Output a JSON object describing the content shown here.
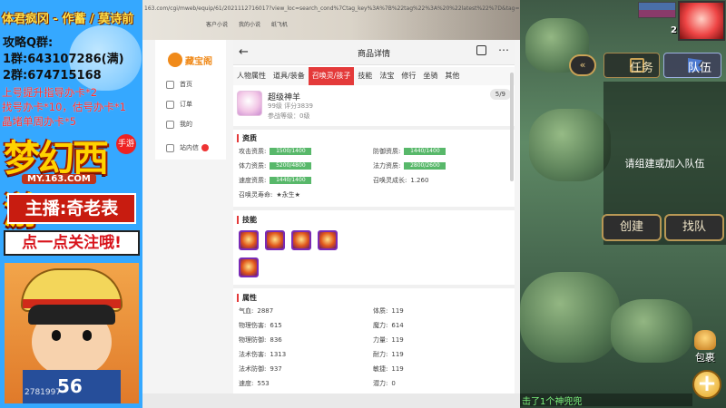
{
  "overlay": {
    "stream_title": "体君疯冈 - 作蓄 / 莫诗前",
    "qq_heading": "攻略Q群:",
    "qq_groups": [
      {
        "label": "1群:",
        "number": "643107286(满)"
      },
      {
        "label": "2群:",
        "number": "674715168"
      }
    ],
    "promo_lines": [
      "上号提升指导办卡*2",
      "找号办卡*10，估号办卡*1",
      "晶堵单周办卡*5"
    ],
    "logo_text": "梦幻西游",
    "logo_url": "MY.163.COM",
    "logo_badge": "手游",
    "host_banner": "主播:奇老表",
    "follow_banner": "点一点关注哦!",
    "avatar_number": "56",
    "watermark_id": "2781997"
  },
  "browser": {
    "url": "163.com/cgi/mweb/equip/61/2021112716017?view_loc=search_cond%7Ctag_key%3A%7B%22tag%22%3A%20%22latest%22%7D&tag=latest",
    "bookmarks": [
      "客户小说",
      "我的小说",
      "纸飞机"
    ]
  },
  "sidebar": {
    "logo": "藏宝阁",
    "items": [
      {
        "label": "首页",
        "icon": "home-icon"
      },
      {
        "label": "订单",
        "icon": "order-icon"
      },
      {
        "label": "我的",
        "icon": "user-icon"
      },
      {
        "label": "站内信",
        "icon": "mail-icon"
      }
    ]
  },
  "detail": {
    "header_title": "商品详情",
    "tabs": [
      "人物属性",
      "道具/装备",
      "召唤灵/孩子",
      "技能",
      "法宝",
      "修行",
      "坐骑",
      "其他"
    ],
    "active_tab": "召唤灵/孩子",
    "pet": {
      "name": "超级神羊",
      "meta": "99级 评分3839",
      "level_line": "参战等级：0级",
      "page": "5/9"
    },
    "aptitude_title": "资质",
    "aptitudes": [
      {
        "label": "攻击资质:",
        "value": "1500/1400"
      },
      {
        "label": "防御资质:",
        "value": "1440/1400"
      },
      {
        "label": "体力资质:",
        "value": "5200/4800"
      },
      {
        "label": "法力资质:",
        "value": "2800/2600"
      },
      {
        "label": "速度资质:",
        "value": "1440/1400"
      }
    ],
    "growth_label": "召唤灵成长:",
    "growth_value": "1.260",
    "lifespan_label": "召唤灵寿命:",
    "lifespan_value": "★永生★",
    "skills_title": "技能",
    "attributes_title": "属性",
    "attributes_left": [
      {
        "label": "气血:",
        "value": "2887"
      },
      {
        "label": "物理伤害:",
        "value": "615"
      },
      {
        "label": "物理防御:",
        "value": "836"
      },
      {
        "label": "法术伤害:",
        "value": "1313"
      },
      {
        "label": "法术防御:",
        "value": "937"
      },
      {
        "label": "速度:",
        "value": "553"
      }
    ],
    "attributes_right": [
      {
        "label": "体质:",
        "value": "119"
      },
      {
        "label": "魔力:",
        "value": "614"
      },
      {
        "label": "力量:",
        "value": "119"
      },
      {
        "label": "耐力:",
        "value": "119"
      },
      {
        "label": "敏捷:",
        "value": "119"
      },
      {
        "label": "潜力:",
        "value": "0"
      }
    ]
  },
  "game": {
    "player_level": "2",
    "task_label": "任务",
    "team_label": "队伍",
    "team_prompt": "请组建或加入队伍",
    "create_label": "创建",
    "find_label": "找队",
    "bag_label": "包裹",
    "plus_label": "+",
    "chat_line": "击了1个神兜兜"
  }
}
